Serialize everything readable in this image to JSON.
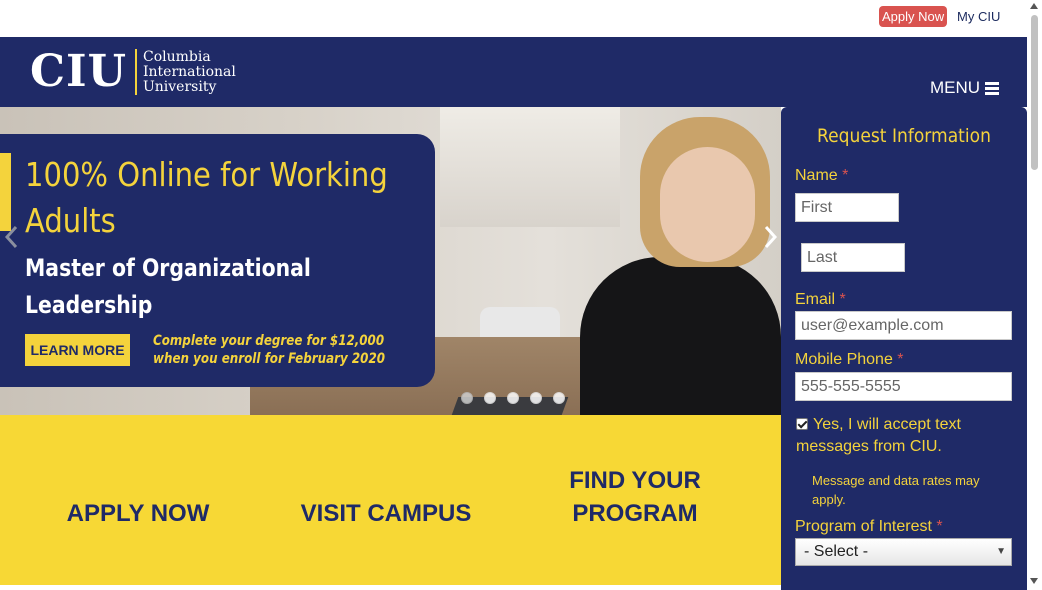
{
  "utility": {
    "apply_now": "Apply Now",
    "my_ciu": "My CIU"
  },
  "header": {
    "logo_mark": "CIU",
    "logo_line1": "Columbia",
    "logo_line2": "International",
    "logo_line3": "University",
    "menu_label": "MENU",
    "menu_icon": "bars-icon"
  },
  "hero": {
    "headline_line1": "100% Online for Working",
    "headline_line2": "Adults",
    "program_line1": "Master of Organizational",
    "program_line2": "Leadership",
    "learn_more": "LEARN MORE",
    "note_line1": "Complete your degree for $12,000",
    "note_line2": "when you enroll for February 2020",
    "slide_count": 5,
    "active_slide": 1
  },
  "cta": {
    "apply": "APPLY NOW",
    "visit": "VISIT CAMPUS",
    "find_line1": "FIND YOUR",
    "find_line2": "PROGRAM"
  },
  "form": {
    "title": "Request Information",
    "name_label": "Name",
    "first_placeholder": "First",
    "last_placeholder": "Last",
    "email_label": "Email",
    "email_placeholder": "user@example.com",
    "phone_label": "Mobile Phone",
    "phone_placeholder": "555-555-5555",
    "required_mark": "*",
    "text_opt_in": "Yes, I will accept text messages from CIU.",
    "rates_note": "Message and data rates may apply.",
    "program_label": "Program of Interest",
    "program_selected": "- Select -"
  },
  "colors": {
    "navy": "#1f2a67",
    "gold": "#f4d33c",
    "cta_yellow": "#f7d835",
    "apply_red": "#d9534f"
  }
}
